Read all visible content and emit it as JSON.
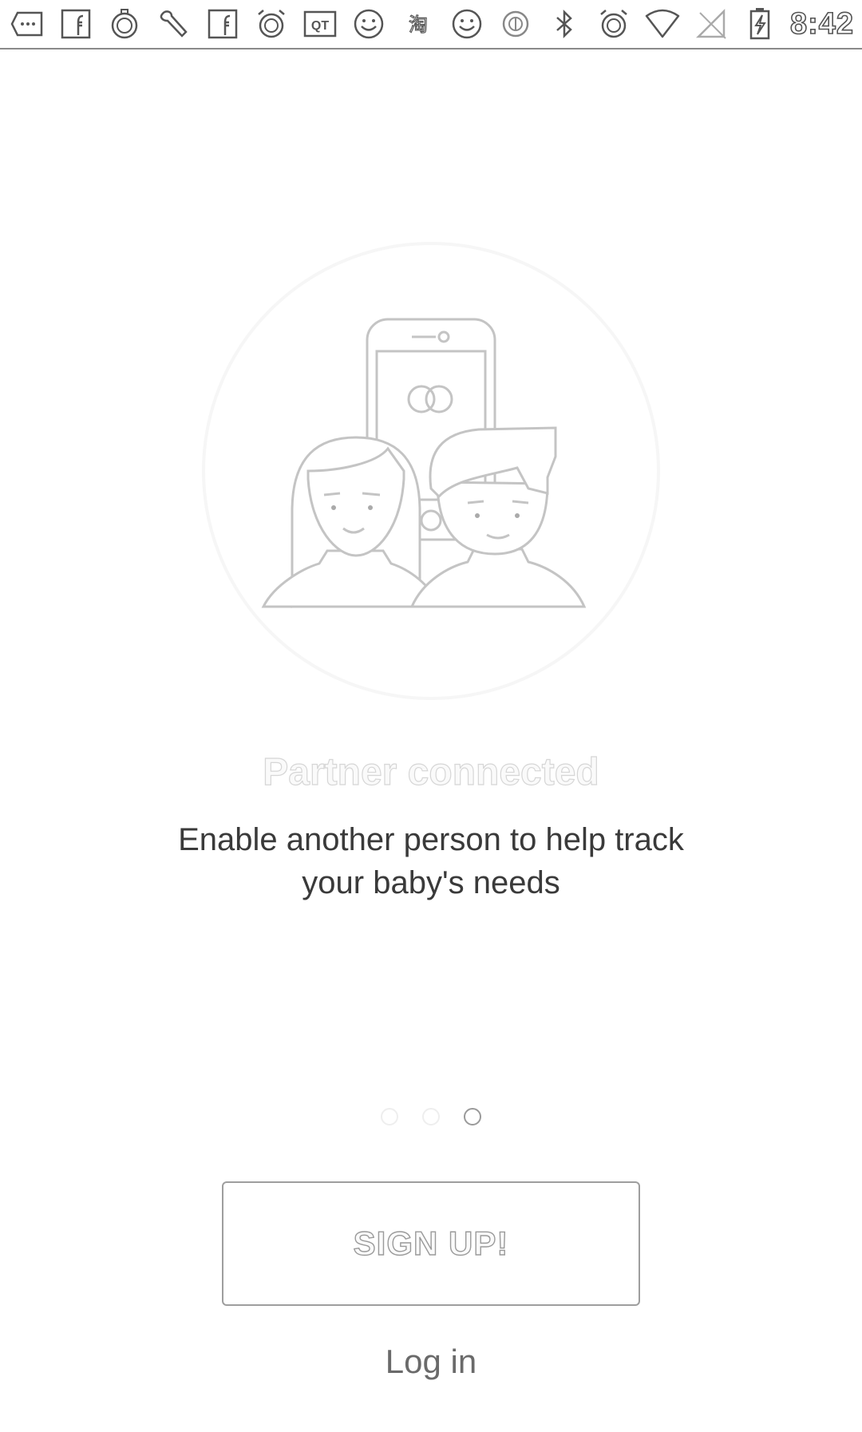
{
  "status_bar": {
    "icons": [
      "more-icon",
      "facebook-icon",
      "stopwatch-icon",
      "wrench-icon",
      "facebook-icon",
      "alarm-icon",
      "qt-icon",
      "smiley-icon",
      "taobao-icon",
      "smiley-icon",
      "sync-icon",
      "bluetooth-icon",
      "alarm-icon",
      "wifi-icon",
      "no-signal-icon",
      "battery-charging-icon"
    ],
    "qt_label": "QT",
    "taobao_label": "淘",
    "time": "8:42"
  },
  "onboarding": {
    "title": "Partner connected",
    "description": "Enable another person to help track your baby's needs",
    "page_count": 3,
    "active_page": 3
  },
  "actions": {
    "signup_label": "SIGN UP!",
    "login_label": "Log in"
  }
}
